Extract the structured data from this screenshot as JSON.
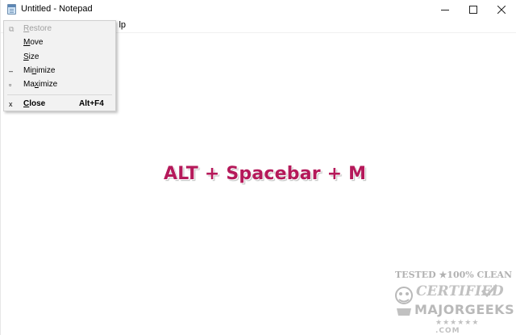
{
  "window": {
    "title": "Untitled - Notepad",
    "icon": "notepad-icon"
  },
  "caption_buttons": {
    "minimize_icon": "minimize-icon",
    "maximize_icon": "maximize-icon",
    "close_icon": "close-icon"
  },
  "menubar": {
    "help_visible_text": "lp"
  },
  "system_menu": {
    "items": [
      {
        "pre": "",
        "accel": "R",
        "post": "estore",
        "shortcut": "",
        "enabled": false,
        "icon": "restore-icon",
        "glyph": "⧉"
      },
      {
        "pre": "",
        "accel": "M",
        "post": "ove",
        "shortcut": "",
        "enabled": true,
        "icon": "",
        "glyph": ""
      },
      {
        "pre": "",
        "accel": "S",
        "post": "ize",
        "shortcut": "",
        "enabled": true,
        "icon": "",
        "glyph": ""
      },
      {
        "pre": "Mi",
        "accel": "n",
        "post": "imize",
        "shortcut": "",
        "enabled": true,
        "icon": "minimize-icon",
        "glyph": "‒"
      },
      {
        "pre": "Ma",
        "accel": "x",
        "post": "imize",
        "shortcut": "",
        "enabled": true,
        "icon": "maximize-icon",
        "glyph": "▫"
      },
      {
        "pre": "",
        "accel": "C",
        "post": "lose",
        "shortcut": "Alt+F4",
        "enabled": true,
        "icon": "close-icon",
        "glyph": "x"
      }
    ]
  },
  "overlay_text": "ALT + Spacebar + M",
  "watermark": {
    "top_line": "TESTED ★100% CLEAN",
    "certified": "CERTIFIED",
    "name": "MAJORGEEKS",
    "suffix": "★★★★★★ .COM"
  },
  "colors": {
    "overlay_text": "#b5195a",
    "menu_background": "#f2f2f2",
    "disabled_text": "#a0a0a0"
  }
}
